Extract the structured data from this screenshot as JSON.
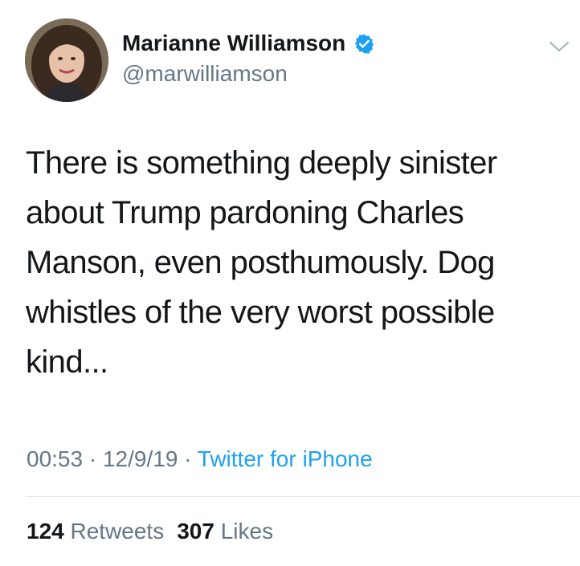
{
  "author": {
    "name": "Marianne Williamson",
    "handle": "@marwilliamson",
    "verified": true
  },
  "tweet": {
    "lines": [
      "There is something deeply sinister",
      "about Trump pardoning Charles",
      "Manson, even posthumously. Dog",
      "whistles of the very worst possible",
      "kind..."
    ]
  },
  "meta": {
    "time": "00:53",
    "sep1": " · ",
    "date": "12/9/19",
    "sep2": " · ",
    "source": "Twitter for iPhone"
  },
  "stats": {
    "retweets_count": "124",
    "retweets_label": " Retweets",
    "likes_count": "307",
    "likes_label": " Likes"
  },
  "icons": {
    "verified": "verified-badge-icon",
    "menu": "chevron-down-icon"
  },
  "colors": {
    "text": "#14171a",
    "secondary": "#657786",
    "link": "#1da1f2",
    "divider": "#e1e8ed"
  }
}
